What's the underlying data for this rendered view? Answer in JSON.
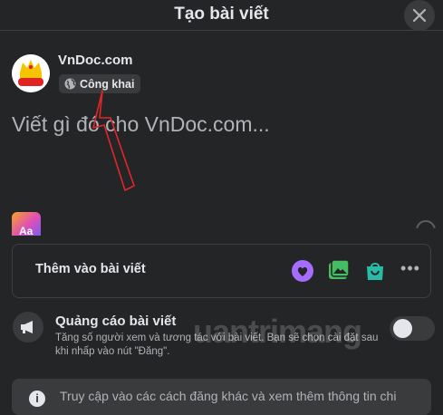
{
  "header": {
    "title": "Tạo bài viết"
  },
  "author": {
    "name": "VnDoc.com",
    "privacy_label": "Công khai",
    "avatar_text": "vndoc"
  },
  "composer": {
    "placeholder": "Viết gì đó cho VnDoc.com..."
  },
  "background_picker": {
    "label": "Aa"
  },
  "add_to_post": {
    "label": "Thêm vào bài viết",
    "icons": [
      "heart-speech-icon",
      "photo-icon",
      "shop-bag-icon",
      "more-icon"
    ],
    "colors": {
      "heart": "#a66cff",
      "photo": "#45bd62",
      "shop": "#2abba7"
    }
  },
  "boost": {
    "title": "Quảng cáo bài viết",
    "description": "Tăng số người xem và tương tác với bài viết. Bạn sẽ chọn cài đặt sau khi nhấp vào nút \"Đăng\".",
    "enabled": false
  },
  "watermark": "uantrimang",
  "info": {
    "text": "Truy cập vào các cách đăng khác và xem thêm thông tin chi"
  },
  "colors": {
    "background": "#242526",
    "surface": "#3a3b3c",
    "annotation": "#e0262b"
  }
}
